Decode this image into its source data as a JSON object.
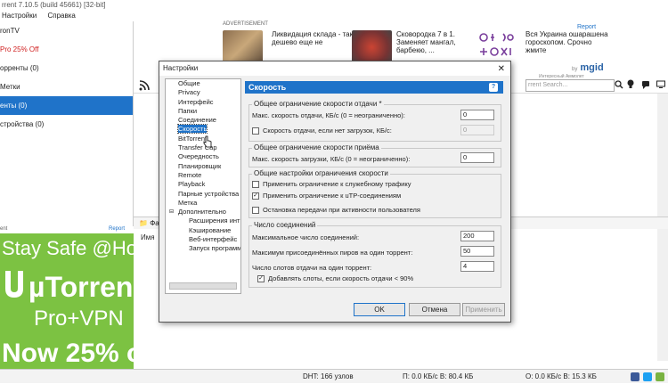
{
  "app": {
    "title": "rrent 7.10.5  (build 45661) [32-bit]"
  },
  "menu": [
    "Настройки",
    "Справка"
  ],
  "sidebar": {
    "items": [
      {
        "label": "ronTV",
        "state": "normal"
      },
      {
        "label": "Pro 25% Off",
        "state": "promo"
      },
      {
        "label": "орренты (0)",
        "state": "normal"
      },
      {
        "label": "Метки",
        "state": "normal"
      },
      {
        "label": "енты (0)",
        "state": "active"
      },
      {
        "label": "стройства (0)",
        "state": "normal"
      }
    ]
  },
  "side_ad": {
    "label": "ent",
    "report": "Report",
    "line1": "Stay Safe @Ho",
    "line2": "µTorren",
    "line3": "Pro+VPN",
    "line4": "Now 25% o"
  },
  "top_ad": {
    "label": "ADVERTISEMENT",
    "report": "Report",
    "cards": [
      {
        "text": "Ликвидация склада - так дешево еще не"
      },
      {
        "text": "Сковородка 7 в 1. Заменяет мангал, барбекю, ..."
      },
      {
        "text": "Вся Украина ошарашена гороскопом. Срочно жмите"
      }
    ],
    "brand": "mgid",
    "brand_prefix": "by",
    "brand_sub": "Интересный Аммолет"
  },
  "toolbar": {
    "search_placeholder": "rrent Search..."
  },
  "details": {
    "tab": "Фа",
    "column": "Имя"
  },
  "status": {
    "dht": "DHT: 166 узлов",
    "down": "П: 0.0 КБ/с В: 80.4 КБ",
    "up": "О: 0.0 КБ/с В: 15.3 КБ"
  },
  "dialog": {
    "title": "Настройки",
    "close": "✕",
    "tree": [
      {
        "label": "Общие",
        "sub": false,
        "selected": false
      },
      {
        "label": "Privacy",
        "sub": false,
        "selected": false
      },
      {
        "label": "Интерфейс",
        "sub": false,
        "selected": false
      },
      {
        "label": "Папки",
        "sub": false,
        "selected": false
      },
      {
        "label": "Соединение",
        "sub": false,
        "selected": false
      },
      {
        "label": "Скорость",
        "sub": false,
        "selected": true
      },
      {
        "label": "BitTorrent",
        "sub": false,
        "selected": false
      },
      {
        "label": "Transfer Cap",
        "sub": false,
        "selected": false
      },
      {
        "label": "Очередность",
        "sub": false,
        "selected": false
      },
      {
        "label": "Планировщик",
        "sub": false,
        "selected": false
      },
      {
        "label": "Remote",
        "sub": false,
        "selected": false
      },
      {
        "label": "Playback",
        "sub": false,
        "selected": false
      },
      {
        "label": "Парные устройства",
        "sub": false,
        "selected": false
      },
      {
        "label": "Метка",
        "sub": false,
        "selected": false
      },
      {
        "label": "Дополнительно",
        "sub": false,
        "selected": false
      },
      {
        "label": "Расширения инт",
        "sub": true,
        "selected": false
      },
      {
        "label": "Кэширование",
        "sub": true,
        "selected": false
      },
      {
        "label": "Веб-интерфейс",
        "sub": true,
        "selected": false
      },
      {
        "label": "Запуск программ",
        "sub": true,
        "selected": false
      }
    ],
    "panel_title": "Скорость",
    "help": "?",
    "upload_group": {
      "title": "Общее ограничение скорости отдачи *",
      "max_upload_label": "Макс. скорость отдачи, КБ/с (0 = неограниченно):",
      "max_upload_value": "0",
      "alt_label": "Скорость отдачи, если нет загрузок, КБ/с:",
      "alt_checked": false,
      "alt_value": "0"
    },
    "download_group": {
      "title": "Общее ограничение скорости приёма",
      "max_download_label": "Макс. скорость загрузки, КБ/с (0 = неограниченно):",
      "max_download_value": "0"
    },
    "general_group": {
      "title": "Общие настройки ограничения скорости",
      "opt1": {
        "label": "Применить ограничение к служебному трафику",
        "checked": false
      },
      "opt2": {
        "label": "Применить ограничение к uTP-соединениям",
        "checked": true
      },
      "opt3": {
        "label": "Остановка передачи при активности пользователя",
        "checked": false
      }
    },
    "conn_group": {
      "title": "Число соединений",
      "max_conn_label": "Максимальное число соединений:",
      "max_conn_value": "200",
      "max_peers_label": "Максимум присоединённых пиров на один торрент:",
      "max_peers_value": "50",
      "slots_label": "Число слотов отдачи на один торрент:",
      "slots_value": "4",
      "extra_slots": {
        "label": "Добавлять слоты, если скорость отдачи < 90%",
        "checked": true
      }
    },
    "buttons": {
      "ok": "OK",
      "cancel": "Отмена",
      "apply": "Применить"
    }
  }
}
